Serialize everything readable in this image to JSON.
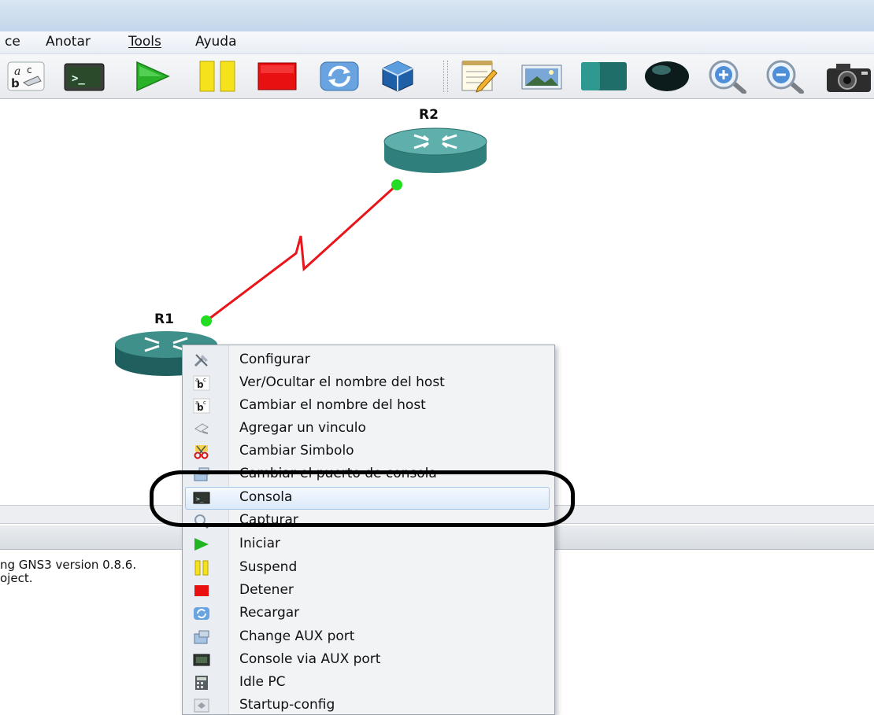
{
  "menubar": {
    "items": [
      "ce",
      "Anotar",
      "Tools",
      "Ayuda"
    ]
  },
  "toolbar": {
    "buttons": [
      "text-label-icon",
      "terminal-icon",
      "start-icon",
      "suspend-icon",
      "stop-icon",
      "reload-icon",
      "virtualbox-icon",
      "notepad-icon",
      "picture-icon",
      "rectangle-icon",
      "ellipse-icon",
      "zoom-in-icon",
      "zoom-out-icon",
      "camera-icon"
    ]
  },
  "topology": {
    "nodes": [
      {
        "name": "R2",
        "type": "router"
      },
      {
        "name": "R1",
        "type": "router"
      }
    ],
    "link": {
      "type": "serial",
      "color": "#e8151b",
      "status": "up",
      "status_color": "#22dd22"
    }
  },
  "console": {
    "lines": [
      "ng GNS3 version 0.8.6.",
      "oject."
    ]
  },
  "context_menu": {
    "items": [
      {
        "label": "Configurar",
        "icon": "wrench-icon"
      },
      {
        "label": "Ver/Ocultar el nombre del host",
        "icon": "text-label-icon"
      },
      {
        "label": "Cambiar el nombre del host",
        "icon": "text-label-icon"
      },
      {
        "label": "Agregar un vinculo",
        "icon": "link-icon"
      },
      {
        "label": "Cambiar Simbolo",
        "icon": "scissors-icon"
      },
      {
        "label": "Cambiar el puerto de consola",
        "icon": "port-icon"
      },
      {
        "label": "Consola",
        "icon": "terminal-icon"
      },
      {
        "label": "Capturar",
        "icon": "capture-icon"
      },
      {
        "label": "Iniciar",
        "icon": "start-icon"
      },
      {
        "label": "Suspend",
        "icon": "suspend-icon"
      },
      {
        "label": "Detener",
        "icon": "stop-icon"
      },
      {
        "label": "Recargar",
        "icon": "reload-icon"
      },
      {
        "label": "Change AUX port",
        "icon": "port-icon"
      },
      {
        "label": "Console via AUX port",
        "icon": "aux-terminal-icon"
      },
      {
        "label": "Idle PC",
        "icon": "calculator-icon"
      },
      {
        "label": "Startup-config",
        "icon": "config-icon"
      }
    ],
    "highlighted": "Consola"
  },
  "colors": {
    "router": "#2f7f7d",
    "link": "#e8151b",
    "status_up": "#22dd22",
    "annotation_ring": "#000000"
  }
}
